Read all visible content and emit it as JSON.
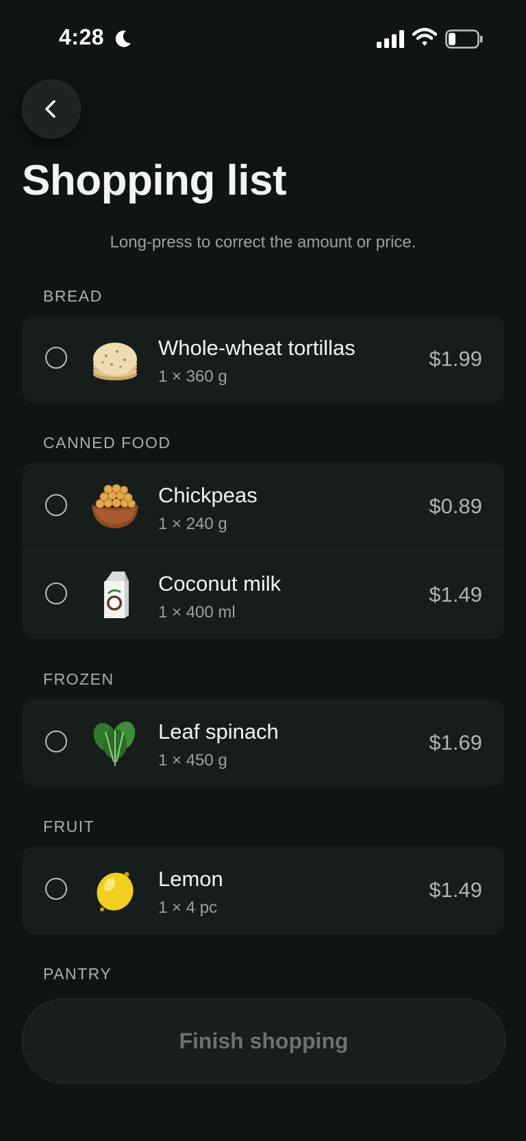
{
  "status_bar": {
    "time": "4:28"
  },
  "header": {
    "title": "Shopping list",
    "hint": "Long-press to correct the amount or price."
  },
  "sections": [
    {
      "label": "BREAD",
      "items": [
        {
          "name": "Whole-wheat tortillas",
          "qty": "1 × 360 g",
          "price": "$1.99",
          "icon": "tortillas-icon"
        }
      ]
    },
    {
      "label": "CANNED FOOD",
      "items": [
        {
          "name": "Chickpeas",
          "qty": "1 × 240 g",
          "price": "$0.89",
          "icon": "chickpeas-icon"
        },
        {
          "name": "Coconut milk",
          "qty": "1 × 400 ml",
          "price": "$1.49",
          "icon": "coconut-milk-icon"
        }
      ]
    },
    {
      "label": "FROZEN",
      "items": [
        {
          "name": "Leaf spinach",
          "qty": "1 × 450 g",
          "price": "$1.69",
          "icon": "spinach-icon"
        }
      ]
    },
    {
      "label": "FRUIT",
      "items": [
        {
          "name": "Lemon",
          "qty": "1 × 4 pc",
          "price": "$1.49",
          "icon": "lemon-icon"
        }
      ]
    },
    {
      "label": "PANTRY",
      "items": []
    }
  ],
  "footer": {
    "finish_label": "Finish shopping"
  },
  "colors": {
    "background": "#0f1512",
    "card": "#171d1a",
    "text": "#f2f5f2",
    "muted": "#9aa39d"
  }
}
